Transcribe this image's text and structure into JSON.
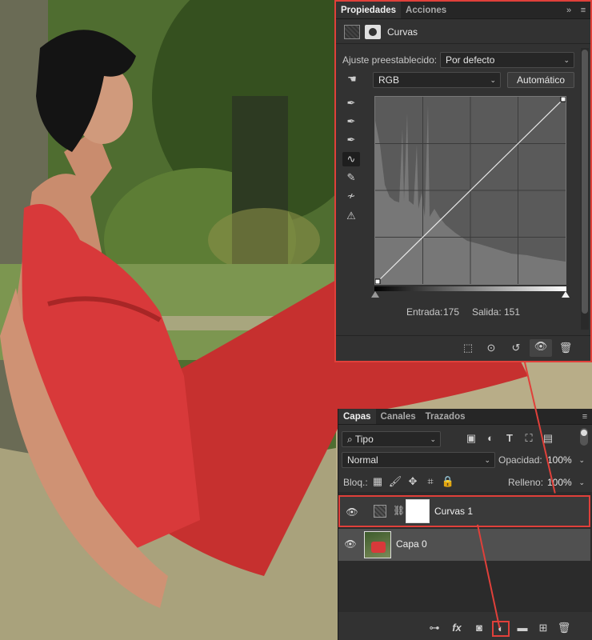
{
  "properties_panel": {
    "tabs": [
      {
        "label": "Propiedades"
      },
      {
        "label": "Acciones"
      }
    ],
    "header_title": "Curvas",
    "preset_label": "Ajuste preestablecido:",
    "preset_value": "Por defecto",
    "channel_value": "RGB",
    "auto_button": "Automático",
    "input_label": "Entrada:",
    "input_value": "175",
    "output_label": "Salida:",
    "output_value": "151",
    "tools": [
      "channel-picker-icon",
      "eyedropper-black-icon",
      "eyedropper-gray-icon",
      "eyedropper-white-icon",
      "curve-points-icon",
      "pencil-icon",
      "smooth-icon",
      "clipping-warning-icon"
    ]
  },
  "layers_panel": {
    "tabs": [
      {
        "label": "Capas"
      },
      {
        "label": "Canales"
      },
      {
        "label": "Trazados"
      }
    ],
    "filter_value": "Tipo",
    "blend_mode": "Normal",
    "opacity_label": "Opacidad:",
    "opacity_value": "100%",
    "lock_label": "Bloq.:",
    "fill_label": "Relleno:",
    "fill_value": "100%",
    "layers": [
      {
        "name": "Curvas 1"
      },
      {
        "name": "Capa 0"
      }
    ],
    "bottom_icons": [
      "link-icon",
      "fx-icon",
      "mask-icon",
      "adjustment-layer-icon",
      "folder-icon",
      "new-layer-icon",
      "trash-icon"
    ]
  },
  "fx_label": "fx",
  "colors": {
    "accent_red": "#e0403a",
    "panel_bg": "#323232",
    "dress": "#d8393a"
  }
}
